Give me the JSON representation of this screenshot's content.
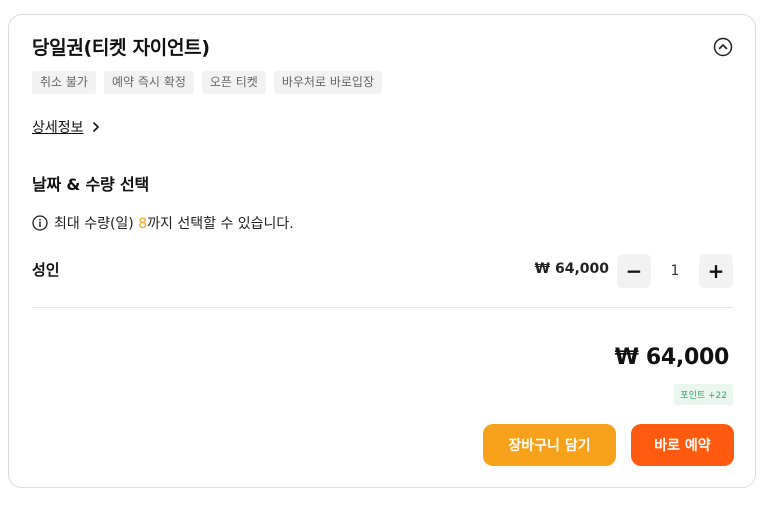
{
  "product": {
    "title": "당일권(티켓 자이언트)",
    "tags": [
      "취소 불가",
      "예약 즉시 확정",
      "오픈 티켓",
      "바우처로 바로입장"
    ],
    "detail_link": "상세정보"
  },
  "selection": {
    "section_title": "날짜 & 수량 선택",
    "notice_prefix": "최대 수량(일)",
    "notice_max": "8",
    "notice_suffix": "까지 선택할 수 있습니다."
  },
  "ticket": {
    "label": "성인",
    "price": "₩ 64,000",
    "quantity": "1",
    "minus": "−",
    "plus": "+"
  },
  "summary": {
    "total": "₩ 64,000",
    "points": "포인트 +22"
  },
  "actions": {
    "cart_label": "장바구니 담기",
    "book_label": "바로 예약"
  },
  "colors": {
    "cart_button": "#f7a01a",
    "book_button": "#ff5a0f",
    "max_qty_highlight": "#f4a020",
    "points_text": "#2aa866"
  },
  "icons": {
    "collapse": "chevron-up-circle-icon",
    "detail_chevron": "chevron-right-icon",
    "notice": "info-circle-icon"
  }
}
